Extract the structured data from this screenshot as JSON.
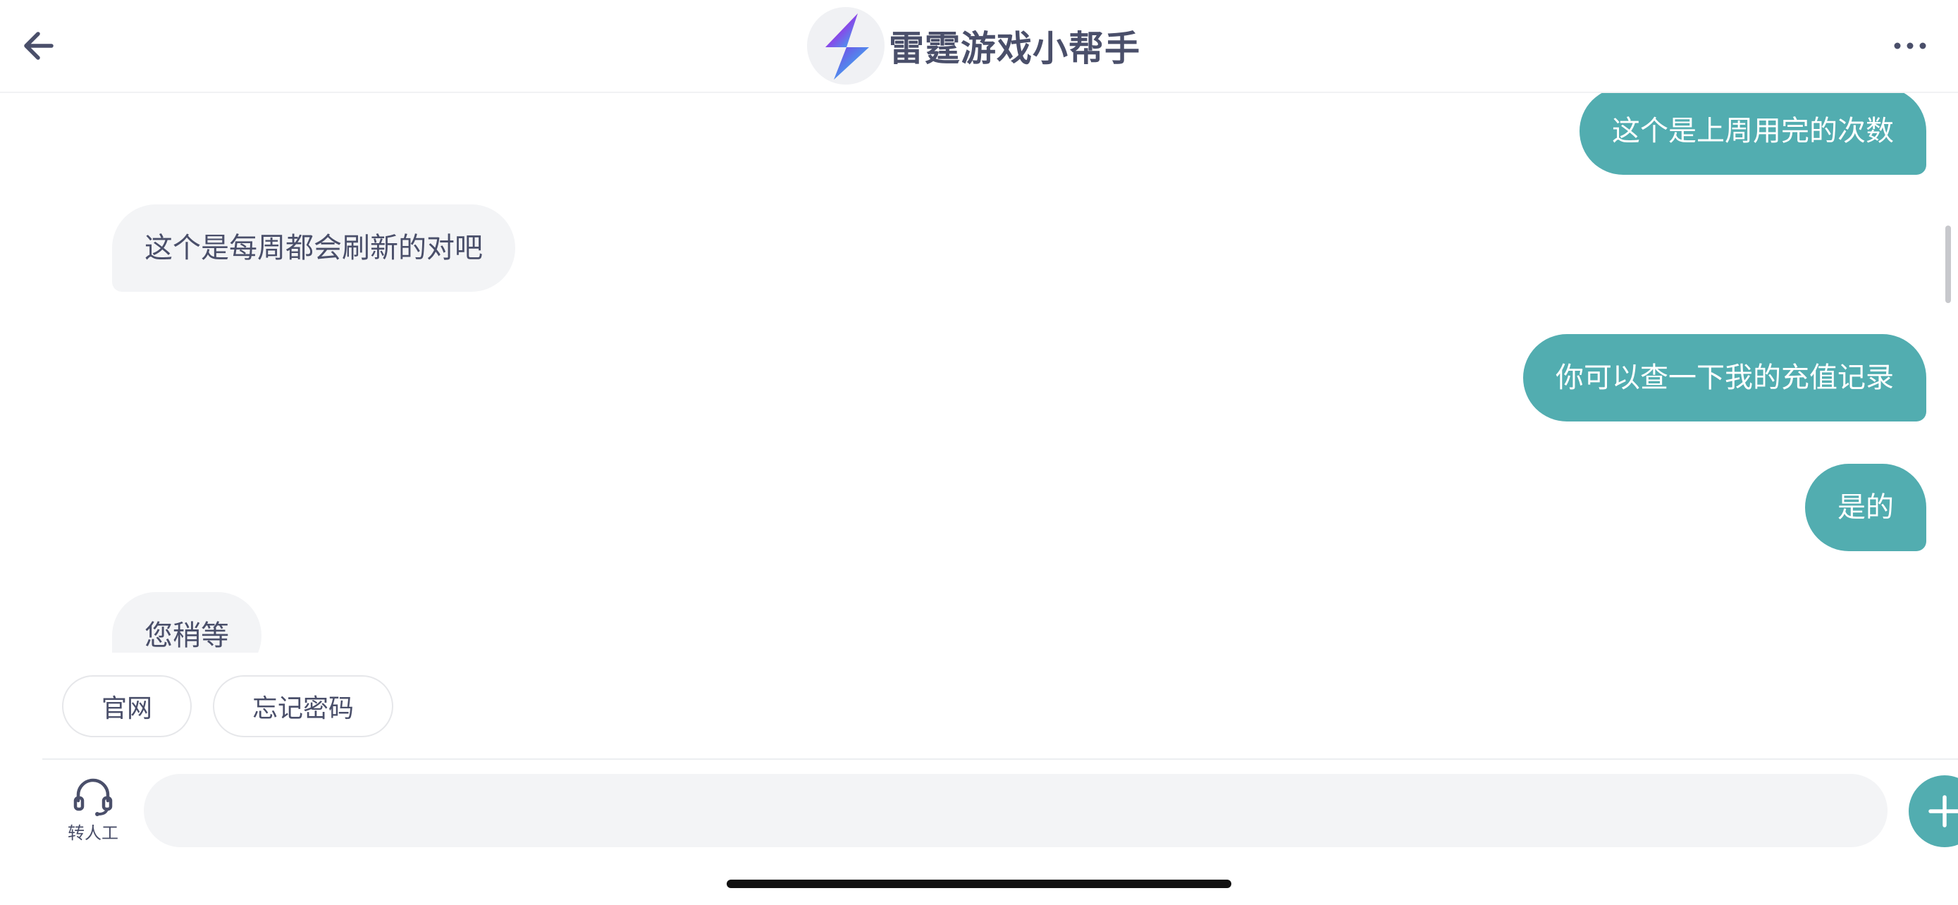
{
  "header": {
    "title": "雷霆游戏小帮手",
    "back_icon": "arrow-left-icon",
    "more_icon": "more-horizontal-icon",
    "logo_icon": "lightning-logo-icon"
  },
  "messages": [
    {
      "side": "right",
      "text": "这个是上周用完的次数"
    },
    {
      "side": "left",
      "text": "这个是每周都会刷新的对吧"
    },
    {
      "side": "right",
      "text": "你可以查一下我的充值记录"
    },
    {
      "side": "right",
      "text": "是的"
    },
    {
      "side": "left",
      "text": "您稍等"
    }
  ],
  "quick_replies": [
    "官网",
    "忘记密码"
  ],
  "input_bar": {
    "agent_label": "转人工",
    "agent_icon": "headset-icon",
    "input_value": "",
    "plus_icon": "plus-icon"
  },
  "colors": {
    "accent": "#52adb0",
    "text": "#4a4f6a",
    "bubble_left": "#f3f4f6",
    "background": "#ffffff"
  }
}
